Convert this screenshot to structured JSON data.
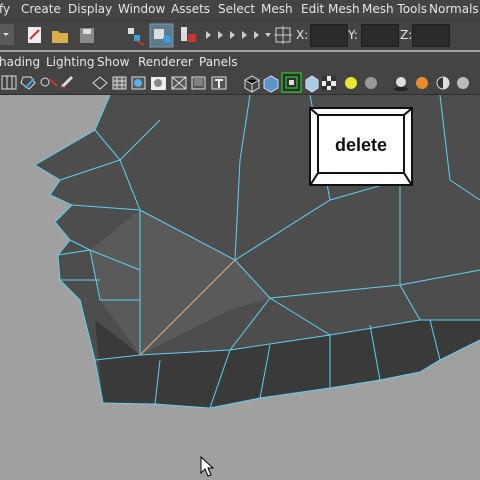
{
  "menu": {
    "items": [
      "fy",
      "Create",
      "Display",
      "Window",
      "Assets",
      "Select",
      "Mesh",
      "Edit Mesh",
      "Mesh Tools",
      "Normals"
    ]
  },
  "status": {
    "x_label": "X:",
    "y_label": "Y:",
    "z_label": "Z:"
  },
  "panel_menu": {
    "items": [
      "hading",
      "Lighting",
      "Show",
      "Renderer",
      "Panels"
    ]
  },
  "overlay": {
    "key_label": "delete"
  },
  "colors": {
    "ui_background": "#444444",
    "viewport_background": "#a0a0a0",
    "wireframe": "#5fd0f0",
    "selected_edge": "#e8a070",
    "mesh_face": "#4a4a4a"
  },
  "icons": [
    "pointer-cursor-icon",
    "new-scene-icon",
    "open-scene-icon",
    "save-scene-icon",
    "camera-icon",
    "render-icon",
    "grid-icon",
    "wireframe-icon",
    "lighting-icon"
  ]
}
